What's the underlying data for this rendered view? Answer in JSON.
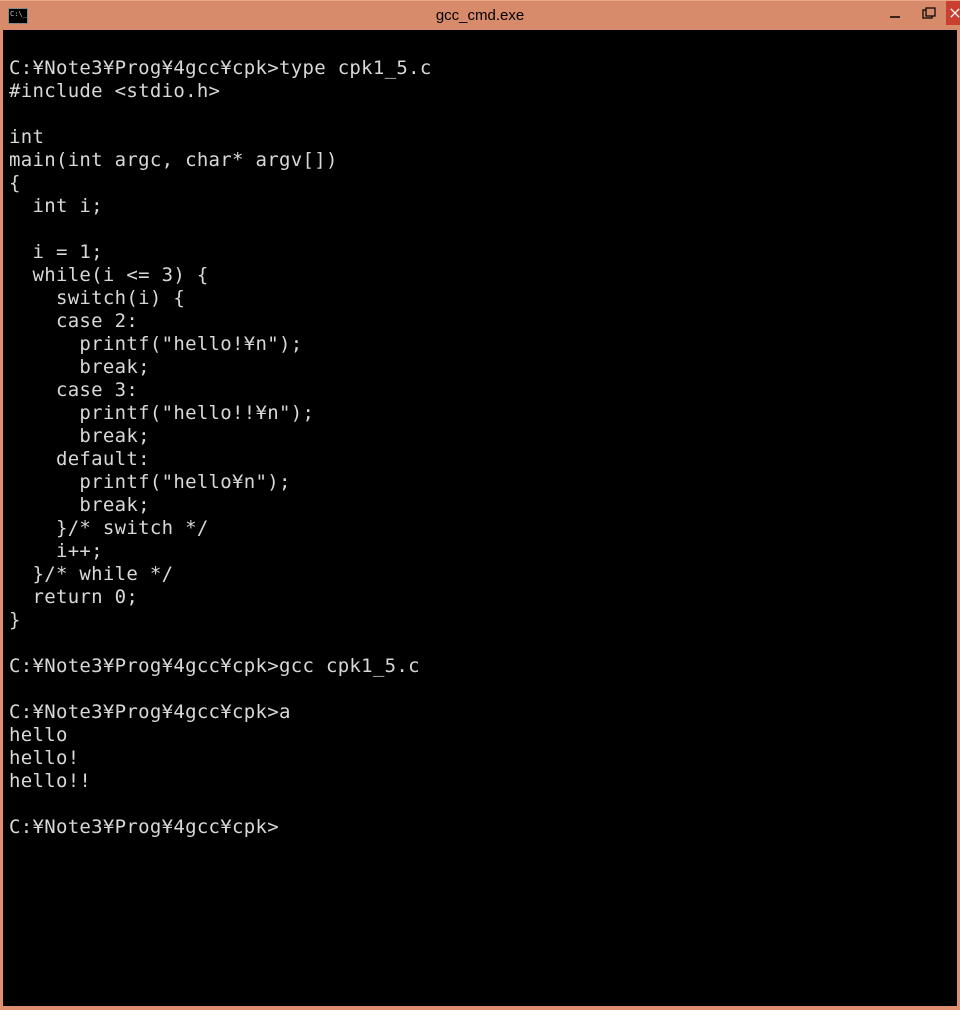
{
  "window": {
    "title": "gcc_cmd.exe"
  },
  "terminal": {
    "lines": [
      "",
      "C:\\Note3\\Prog\\4gcc\\cpk>type cpk1_5.c",
      "#include <stdio.h>",
      "",
      "int",
      "main(int argc, char* argv[])",
      "{",
      "  int i;",
      "",
      "  i = 1;",
      "  while(i <= 3) {",
      "    switch(i) {",
      "    case 2:",
      "      printf(\"hello!\\n\");",
      "      break;",
      "    case 3:",
      "      printf(\"hello!!\\n\");",
      "      break;",
      "    default:",
      "      printf(\"hello\\n\");",
      "      break;",
      "    }/* switch */",
      "    i++;",
      "  }/* while */",
      "  return 0;",
      "}",
      "",
      "C:\\Note3\\Prog\\4gcc\\cpk>gcc cpk1_5.c",
      "",
      "C:\\Note3\\Prog\\4gcc\\cpk>a",
      "hello",
      "hello!",
      "hello!!",
      "",
      "C:\\Note3\\Prog\\4gcc\\cpk>"
    ]
  }
}
